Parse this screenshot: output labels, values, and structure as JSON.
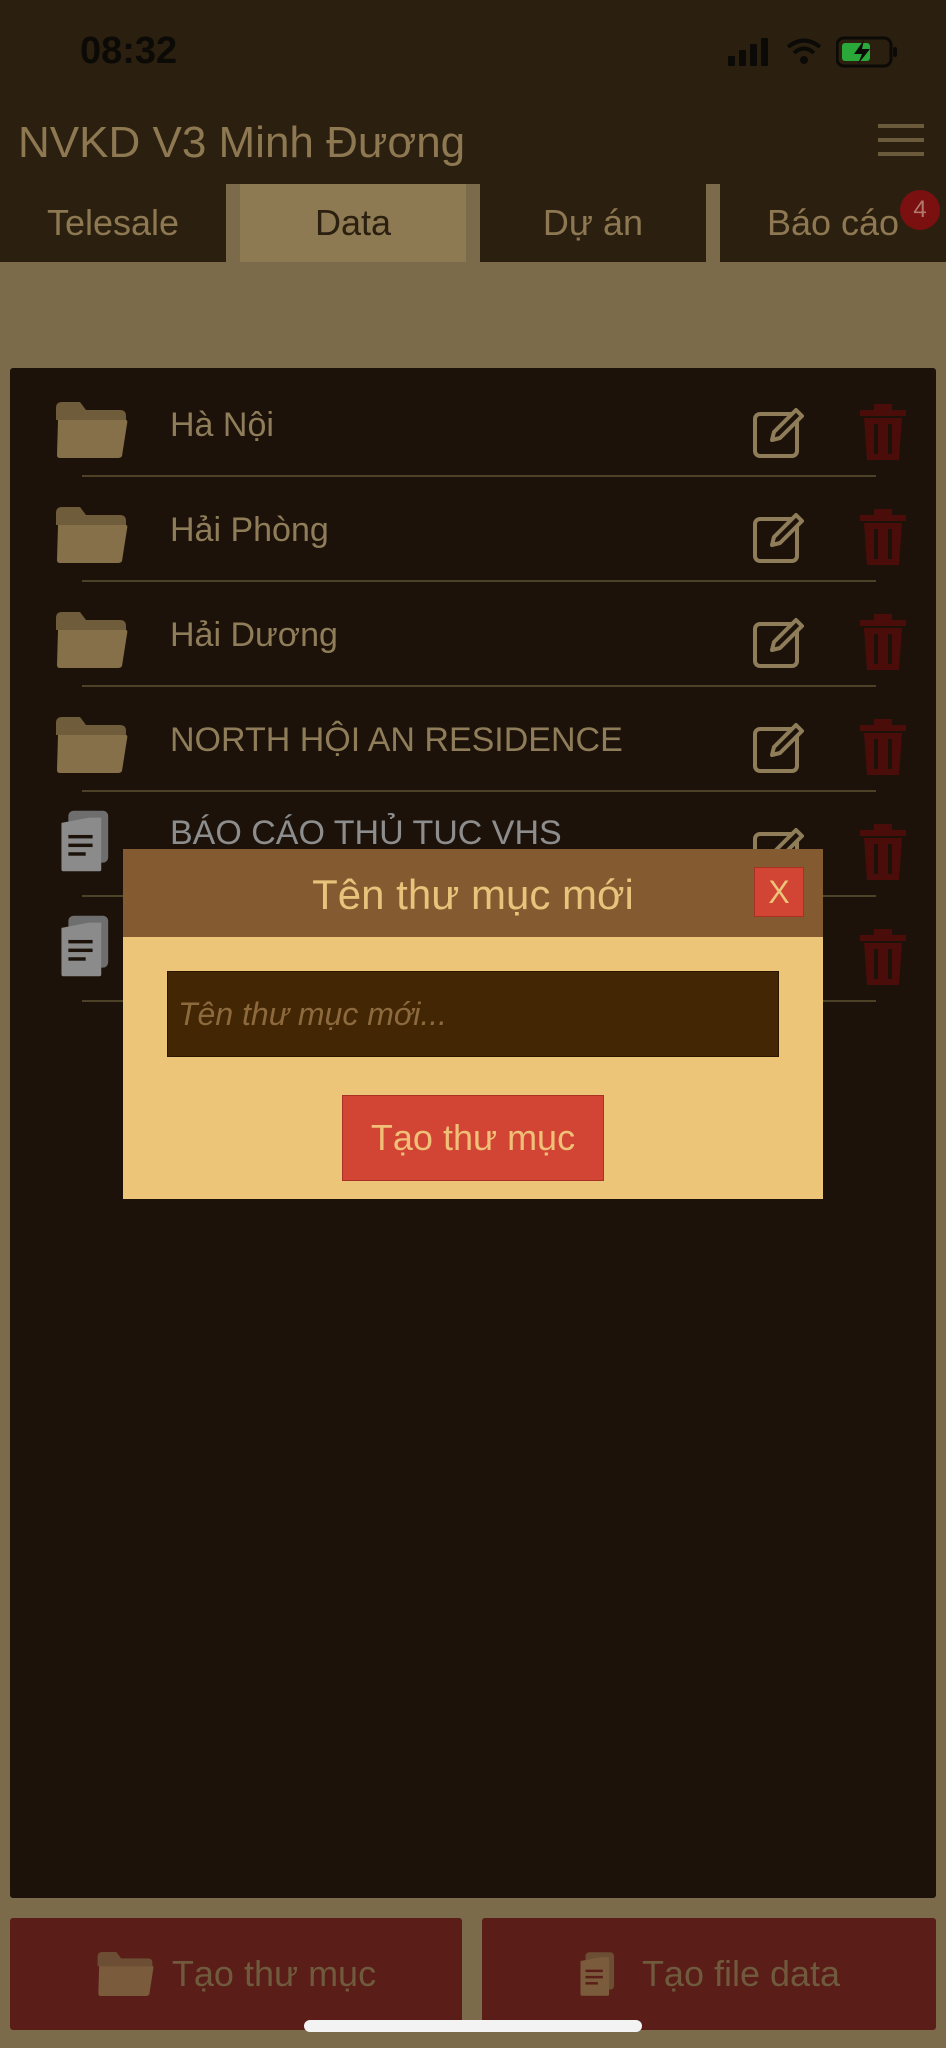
{
  "status_bar": {
    "time": "08:32"
  },
  "header": {
    "title": "NVKD V3 Minh Đương"
  },
  "tabs": [
    {
      "label": "Telesale"
    },
    {
      "label": "Data"
    },
    {
      "label": "Dự án"
    },
    {
      "label": "Báo cáo",
      "badge": "4"
    }
  ],
  "list": {
    "items": [
      {
        "type": "folder",
        "label": "Hà Nội"
      },
      {
        "type": "folder",
        "label": "Hải Phòng"
      },
      {
        "type": "folder",
        "label": "Hải Dương"
      },
      {
        "type": "folder",
        "label": "NORTH HỘI AN RESIDENCE"
      },
      {
        "type": "file",
        "label": "BÁO CÁO THỦ TUC VHS"
      },
      {
        "type": "file",
        "label": ""
      }
    ]
  },
  "bottom_bar": {
    "create_folder_label": "Tạo thư mục",
    "create_file_label": "Tạo file data"
  },
  "modal": {
    "title": "Tên thư mục mới",
    "close_label": "X",
    "input_placeholder": "Tên thư mục mới...",
    "input_value": "",
    "create_label": "Tạo thư mục"
  },
  "colors": {
    "accent_red": "#d24434",
    "modal_bg": "#ecc579",
    "header_bg": "#2b1f0f"
  }
}
